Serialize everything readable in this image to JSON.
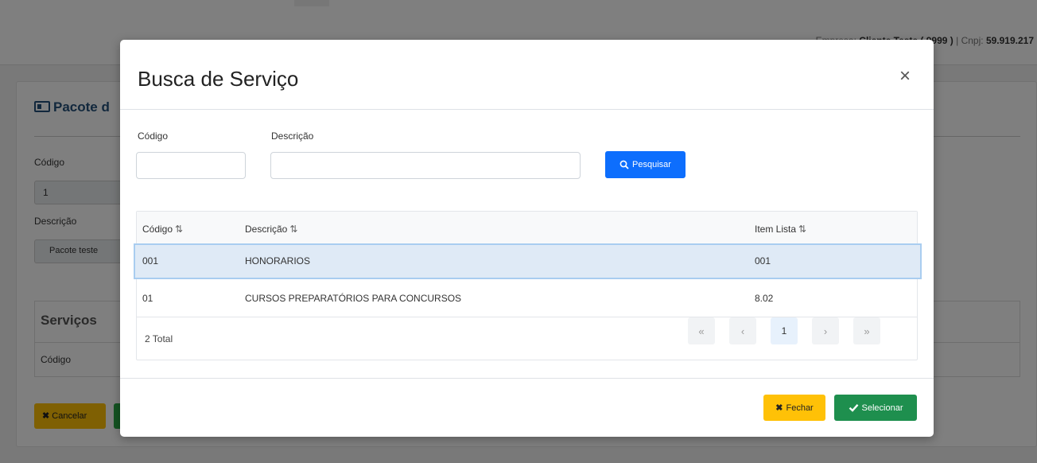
{
  "header": {
    "company_label": "Empresa:",
    "company_name": "Cliente Teste ( 9999 )",
    "cnpj_label": "| Cnpj:",
    "cnpj_value": "59.919.217"
  },
  "background_page": {
    "card_title": "Pacote d",
    "codigo_label": "Código",
    "codigo_value": "1",
    "descricao_label": "Descrição",
    "descricao_value": "Pacote teste",
    "servicos_title": "Serviços",
    "servicos_col_codigo": "Código",
    "cancelar_label": "Cancelar",
    "cancel_icon": "x-icon"
  },
  "modal": {
    "title": "Busca de Serviço",
    "close_glyph": "×",
    "filters": {
      "codigo_label": "Código",
      "codigo_value": "",
      "descricao_label": "Descrição",
      "descricao_value": "",
      "search_button": "Pesquisar",
      "search_icon": "search-icon"
    },
    "table": {
      "columns": [
        "Código",
        "Descrição",
        "Item Lista"
      ],
      "sort_icon": "⇅",
      "rows": [
        {
          "codigo": "001",
          "descricao": "HONORARIOS",
          "item_lista": "001",
          "selected": true
        },
        {
          "codigo": "01",
          "descricao": "CURSOS PREPARATÓRIOS PARA CONCURSOS",
          "item_lista": "8.02",
          "selected": false
        }
      ],
      "total": "2 Total",
      "pagination": {
        "first": "«",
        "prev": "‹",
        "current_page": "1",
        "next": "›",
        "last": "»"
      }
    },
    "footer": {
      "fechar_label": "Fechar",
      "fechar_icon": "x-icon",
      "selecionar_label": "Selecionar",
      "selecionar_icon": "check-icon"
    }
  },
  "colors": {
    "primary": "#0d6efd",
    "warning": "#ffc107",
    "success": "#1e8f4e",
    "selected_row": "#dfeaf6",
    "card_title": "#24507a"
  }
}
